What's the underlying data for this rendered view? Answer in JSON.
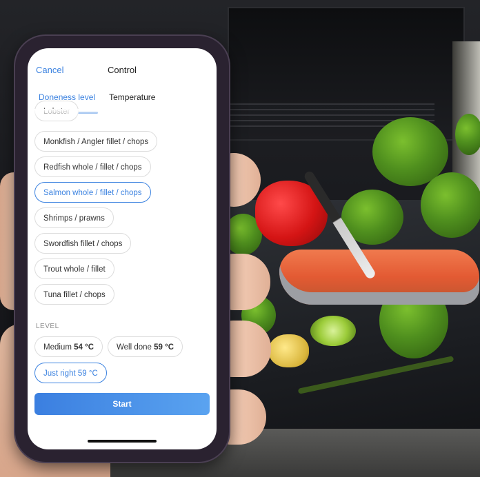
{
  "header": {
    "cancel_label": "Cancel",
    "title": "Control"
  },
  "tabs": [
    {
      "label": "Doneness level",
      "active": true
    },
    {
      "label": "Temperature",
      "active": false
    }
  ],
  "fish_list": {
    "partial_item": "Lobster",
    "items": [
      {
        "label": "Monkfish / Angler fillet / chops",
        "selected": false
      },
      {
        "label": "Redfish whole / fillet / chops",
        "selected": false
      },
      {
        "label": "Salmon whole / fillet / chops",
        "selected": true
      },
      {
        "label": "Shrimps / prawns",
        "selected": false
      },
      {
        "label": "Swordfish fillet / chops",
        "selected": false
      },
      {
        "label": "Trout whole / fillet",
        "selected": false
      },
      {
        "label": "Tuna fillet / chops",
        "selected": false
      }
    ]
  },
  "level": {
    "section_label": "LEVEL",
    "options": [
      {
        "name": "Medium",
        "temp": "54 °C",
        "selected": false
      },
      {
        "name": "Well done",
        "temp": "59 °C",
        "selected": false
      },
      {
        "name": "Just right",
        "temp": "59 °C",
        "selected": true
      }
    ]
  },
  "actions": {
    "start_label": "Start"
  },
  "colors": {
    "accent": "#3b82e0",
    "chip_border": "#dcdcdc"
  }
}
